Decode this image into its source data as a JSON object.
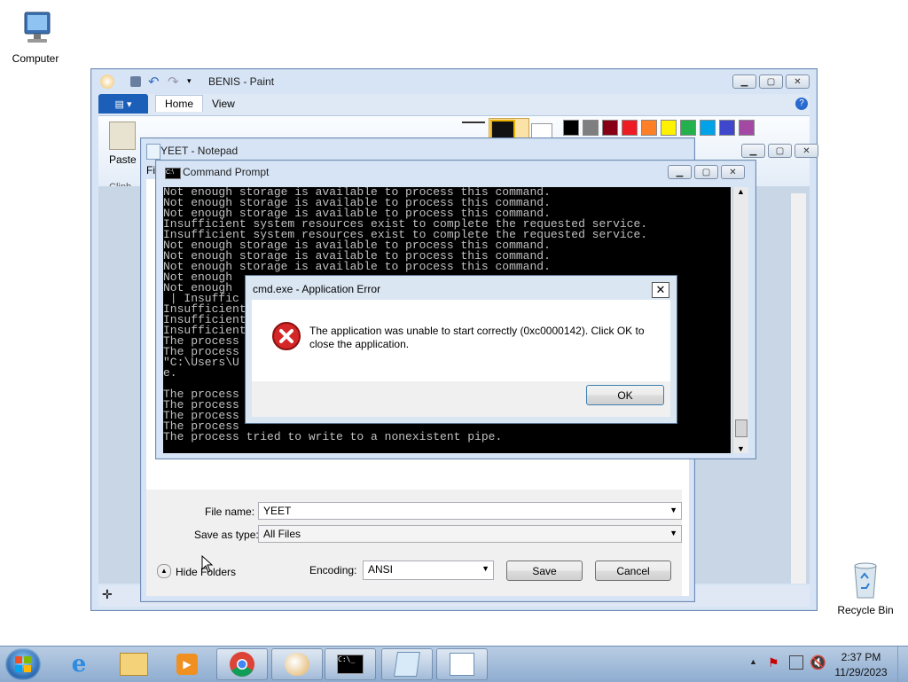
{
  "desktop": {
    "icons": [
      {
        "label": "Computer",
        "icon": "computer-icon"
      },
      {
        "label": "Recycle Bin",
        "icon": "recycle-bin-icon"
      }
    ]
  },
  "paint": {
    "title": "BENIS - Paint",
    "tabs": [
      "Home",
      "View"
    ],
    "paste_label": "Paste",
    "clipboard_group": "Clipb",
    "palette": [
      "#000000",
      "#7f7f7f",
      "#880015",
      "#ed1c24",
      "#ff7f27",
      "#fff200",
      "#22b14c",
      "#00a2e8",
      "#3f48cc",
      "#a349a4"
    ]
  },
  "notepad": {
    "title": "YEET - Notepad",
    "menu_fragment": "Fi",
    "save_dialog": {
      "file_name_label": "File name:",
      "file_name_value": "YEET",
      "save_as_type_label": "Save as type:",
      "save_as_type_value": "All Files",
      "hide_folders_label": "Hide Folders",
      "encoding_label": "Encoding:",
      "encoding_value": "ANSI",
      "save_button": "Save",
      "cancel_button": "Cancel"
    }
  },
  "cmd": {
    "title": "Command Prompt",
    "lines": [
      "Not enough storage is available to process this command.",
      "Not enough storage is available to process this command.",
      "Not enough storage is available to process this command.",
      "Insufficient system resources exist to complete the requested service.",
      "Insufficient system resources exist to complete the requested service.",
      "Not enough storage is available to process this command.",
      "Not enough storage is available to process this command.",
      "Not enough storage is available to process this command.",
      "Not enough",
      "Not enough",
      " | Insuffic",
      "Insufficient",
      "Insufficient",
      "Insufficient",
      "The process",
      "The process",
      "\"C:\\Users\\U                                                    tent pip",
      "e.",
      "",
      "The process",
      "The process",
      "The process",
      "The process",
      "The process tried to write to a nonexistent pipe."
    ]
  },
  "error_dialog": {
    "title": "cmd.exe - Application Error",
    "message_line1": "The application was unable to start correctly (0xc0000142). Click OK to",
    "message_line2": "close the application.",
    "ok_button": "OK"
  },
  "taskbar": {
    "time": "2:37 PM",
    "date": "11/29/2023",
    "apps": [
      "Internet Explorer",
      "Windows Explorer",
      "Media Player",
      "Chrome",
      "Paint",
      "Command Prompt",
      "Notepad",
      "Document"
    ]
  }
}
